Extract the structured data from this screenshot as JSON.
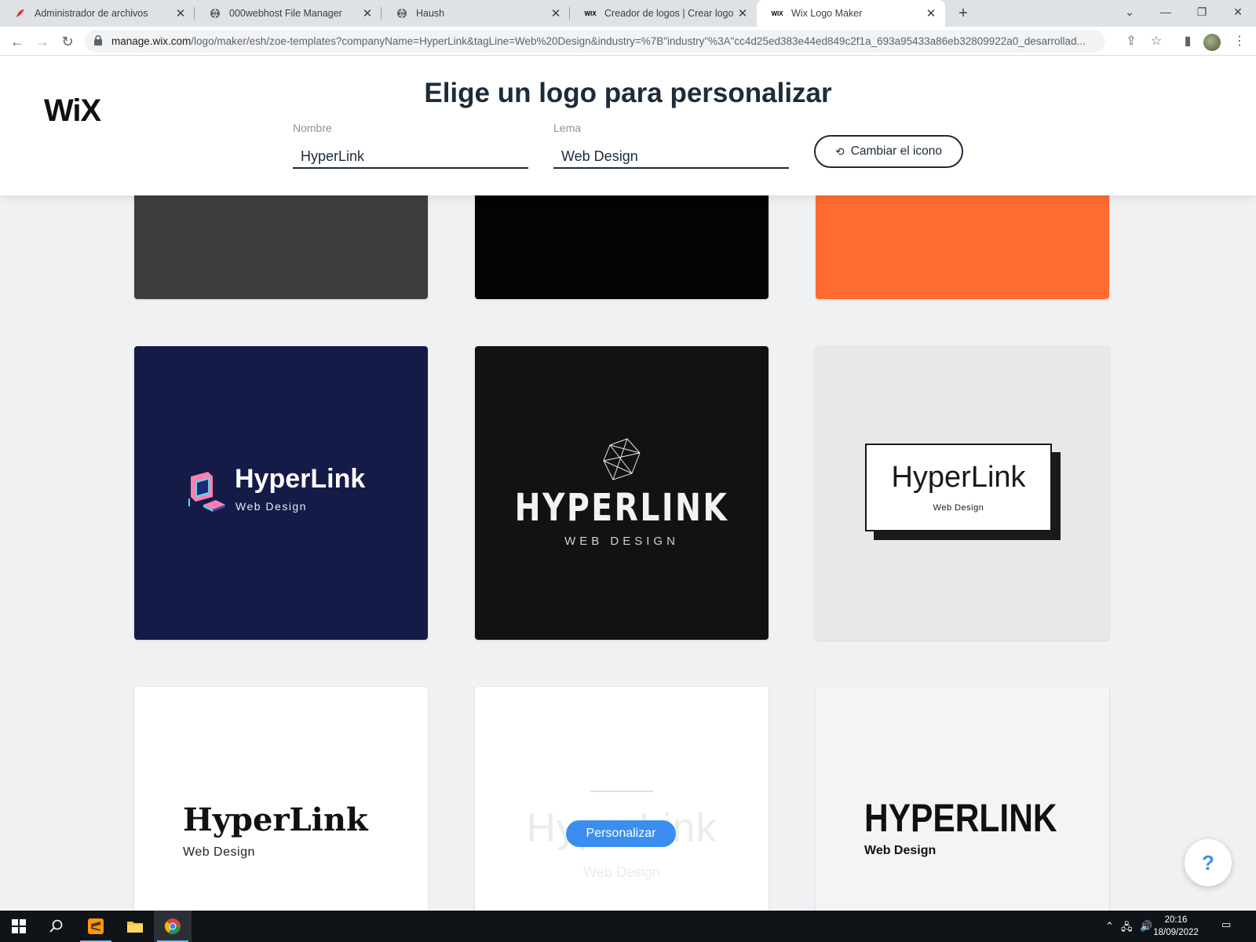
{
  "browser": {
    "tabs": [
      {
        "title": "Administrador de archivos",
        "icon": "filemanager-favicon"
      },
      {
        "title": "000webhost File Manager",
        "icon": "globe-favicon"
      },
      {
        "title": "Haush",
        "icon": "globe-favicon"
      },
      {
        "title": "Creador de logos | Crear logo gra",
        "icon": "wix-favicon"
      },
      {
        "title": "Wix Logo Maker",
        "icon": "wix-favicon",
        "active": true
      }
    ],
    "url_host": "manage.wix.com",
    "url_path": "/logo/maker/esh/zoe-templates?companyName=HyperLink&tagLine=Web%20Design&industry=%7B\"industry\"%3A\"cc4d25ed383e44ed849c2f1a_693a95433a86eb32809922a0_desarrollad..."
  },
  "header": {
    "brand": "WiX",
    "title": "Elige un logo para personalizar",
    "name_label": "Nombre",
    "name_value": "HyperLink",
    "tagline_label": "Lema",
    "tagline_value": "Web Design",
    "change_icon_label": "Cambiar el icono"
  },
  "cards": {
    "top_row_colors": [
      "#3d3d3d",
      "#020405",
      "#ff6b30"
    ],
    "c4": {
      "name": "HyperLink",
      "tag": "Web Design",
      "bg": "#141b47"
    },
    "c5": {
      "name": "HYPERLINK",
      "tag": "WEB DESIGN",
      "bg": "#121212"
    },
    "c6": {
      "name": "HyperLink",
      "tag": "Web Design",
      "bg": "#e8e8e8"
    },
    "c7": {
      "name": "HyperLink",
      "tag": "Web Design",
      "bg": "#ffffff"
    },
    "c8": {
      "name": "HyperLink",
      "tag": "Web Design",
      "bg": "#ffffff",
      "button": "Personalizar"
    },
    "c9": {
      "name": "HYPERLINK",
      "tag": "Web Design",
      "bg": "#f4f4f4"
    }
  },
  "help": {
    "label": "?"
  },
  "taskbar": {
    "time": "20:16",
    "date": "18/09/2022"
  }
}
